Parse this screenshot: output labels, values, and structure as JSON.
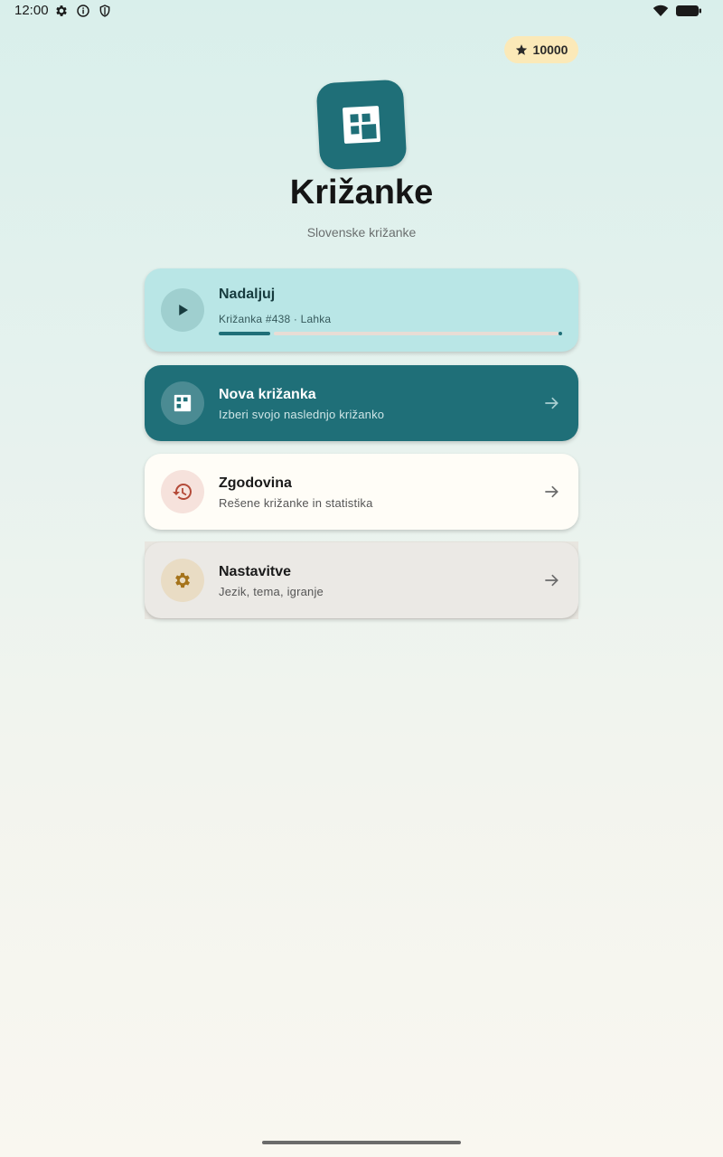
{
  "status_bar": {
    "time": "12:00",
    "icons_left": [
      "settings-icon",
      "info-icon",
      "shield-icon"
    ],
    "icons_right": [
      "wifi-icon",
      "battery-icon"
    ]
  },
  "coins": {
    "value": "10000",
    "icon": "star-icon",
    "color": "#fbe9b8"
  },
  "app": {
    "title": "Križanke",
    "subtitle": "Slovenske križanke",
    "logo_icon": "crossword-grid-icon",
    "accent": "#1f6f78"
  },
  "cards": {
    "continue": {
      "title": "Nadaljuj",
      "subtitle": "Križanka #438 · Lahka",
      "icon": "play-icon",
      "progress": 0.15
    },
    "new": {
      "title": "Nova križanka",
      "subtitle": "Izberi svojo naslednjo križanko",
      "icon": "crossword-grid-icon"
    },
    "history": {
      "title": "Zgodovina",
      "subtitle": "Rešene križanke in statistika",
      "icon": "history-icon"
    },
    "settings": {
      "title": "Nastavitve",
      "subtitle": "Jezik, tema, igranje",
      "icon": "gear-icon"
    }
  }
}
